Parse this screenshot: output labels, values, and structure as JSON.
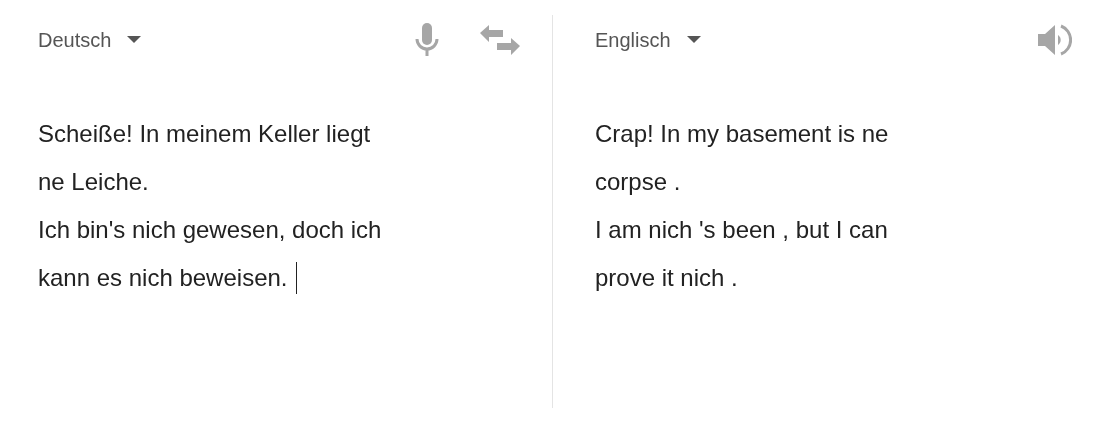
{
  "source": {
    "language": "Deutsch",
    "lines": [
      "Scheiße! In meinem Keller liegt",
      "ne Leiche.",
      "Ich bin's nich gewesen, doch ich",
      "kann es nich beweisen."
    ]
  },
  "target": {
    "language": "Englisch",
    "lines": [
      "Crap! In my basement is ne",
      "corpse .",
      "I am nich 's been , but I can",
      "prove it nich ."
    ]
  }
}
